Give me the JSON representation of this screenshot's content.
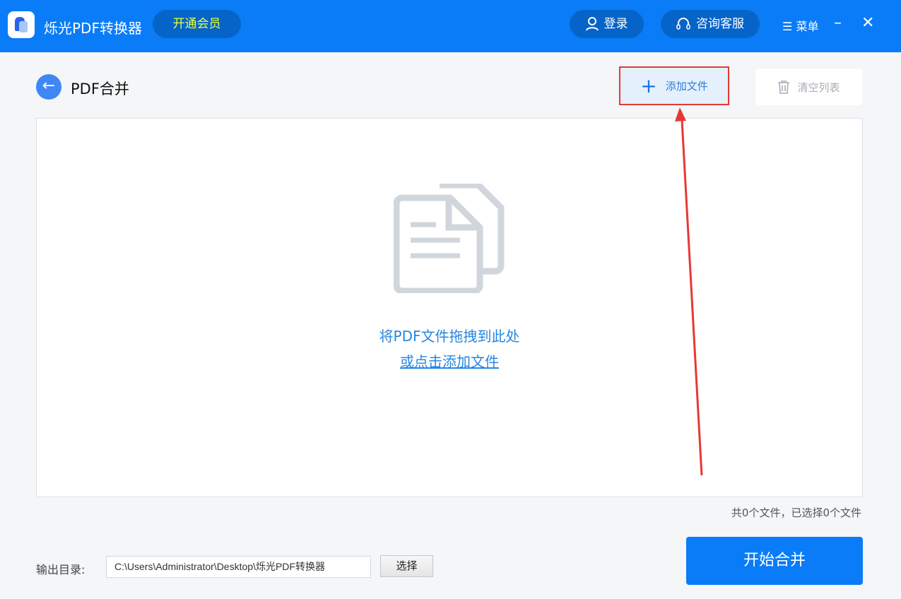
{
  "app": {
    "title": "烁光PDF转换器",
    "vip_label": "开通会员",
    "login_label": "登录",
    "support_label": "咨询客服",
    "menu_label": "菜单"
  },
  "page": {
    "title": "PDF合并",
    "add_file_label": "添加文件",
    "clear_list_label": "清空列表"
  },
  "dropzone": {
    "hint": "将PDF文件拖拽到此处",
    "link": "或点击添加文件"
  },
  "status": {
    "count_text": "共0个文件，已选择0个文件"
  },
  "output": {
    "label": "输出目录:",
    "path": "C:\\Users\\Administrator\\Desktop\\烁光PDF转换器",
    "choose_label": "选择"
  },
  "actions": {
    "start_label": "开始合并"
  },
  "colors": {
    "brand": "#0a7cf7",
    "vip_text": "#e6ff3a",
    "annotation": "#e53935"
  }
}
